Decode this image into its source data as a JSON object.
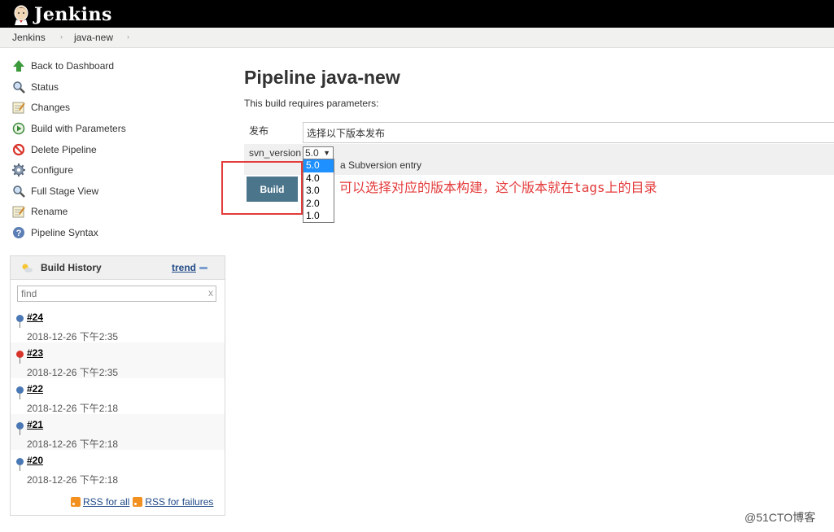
{
  "header": {
    "brand": "Jenkins"
  },
  "breadcrumbs": [
    "Jenkins",
    "java-new"
  ],
  "sidebar": {
    "items": [
      {
        "label": "Back to Dashboard",
        "icon": "up-arrow-icon"
      },
      {
        "label": "Status",
        "icon": "magnifier-icon"
      },
      {
        "label": "Changes",
        "icon": "notepad-icon"
      },
      {
        "label": "Build with Parameters",
        "icon": "clock-play-icon"
      },
      {
        "label": "Delete Pipeline",
        "icon": "no-entry-icon"
      },
      {
        "label": "Configure",
        "icon": "gear-icon"
      },
      {
        "label": "Full Stage View",
        "icon": "magnifier-icon"
      },
      {
        "label": "Rename",
        "icon": "notepad-icon"
      },
      {
        "label": "Pipeline Syntax",
        "icon": "help-icon"
      }
    ]
  },
  "build_history": {
    "title": "Build History",
    "trend": "trend",
    "find_placeholder": "find",
    "clear": "x",
    "builds": [
      {
        "number": "#24",
        "time": "2018-12-26 下午2:35",
        "status": "success",
        "color": "#4a78b5"
      },
      {
        "number": "#23",
        "time": "2018-12-26 下午2:35",
        "status": "failed",
        "color": "#d9342b"
      },
      {
        "number": "#22",
        "time": "2018-12-26 下午2:18",
        "status": "success",
        "color": "#4a78b5"
      },
      {
        "number": "#21",
        "time": "2018-12-26 下午2:18",
        "status": "success",
        "color": "#4a78b5"
      },
      {
        "number": "#20",
        "time": "2018-12-26 下午2:18",
        "status": "success",
        "color": "#4a78b5"
      }
    ],
    "rss_all": "RSS for all",
    "rss_failures": "RSS for failures"
  },
  "main": {
    "title": "Pipeline java-new",
    "description": "This build requires parameters:",
    "params": [
      {
        "name": "发布",
        "value": "选择以下版本发布"
      },
      {
        "name": "svn_version",
        "value": "5.0",
        "description": "a Subversion entry",
        "options": [
          "5.0",
          "4.0",
          "3.0",
          "2.0",
          "1.0"
        ]
      }
    ],
    "build_label": "Build"
  },
  "annotation": "可以选择对应的版本构建，这个版本就在tags上的目录",
  "watermark": "@51CTO博客"
}
